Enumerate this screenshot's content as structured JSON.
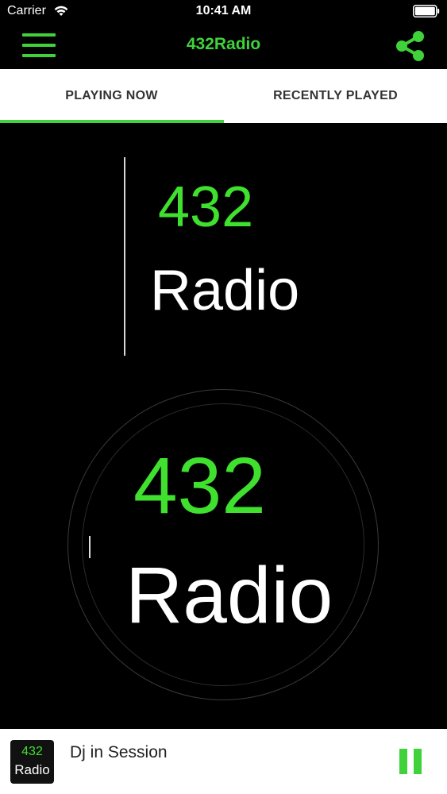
{
  "status_bar": {
    "carrier": "Carrier",
    "time": "10:41 AM",
    "icons": [
      "wifi-icon",
      "battery-icon"
    ]
  },
  "nav": {
    "title": "432Radio",
    "menu_icon": "menu-icon",
    "share_icon": "share-icon"
  },
  "tabs": [
    {
      "label": "PLAYING NOW",
      "active": true
    },
    {
      "label": "RECENTLY PLAYED",
      "active": false
    }
  ],
  "artwork": {
    "number": "432",
    "word": "Radio"
  },
  "player": {
    "thumb_number": "432",
    "thumb_word": "Radio",
    "track_title": "Dj in Session",
    "control_icon": "pause-icon"
  },
  "colors": {
    "accent": "#3fd23a",
    "background": "#000000",
    "bar_background": "#ffffff"
  }
}
